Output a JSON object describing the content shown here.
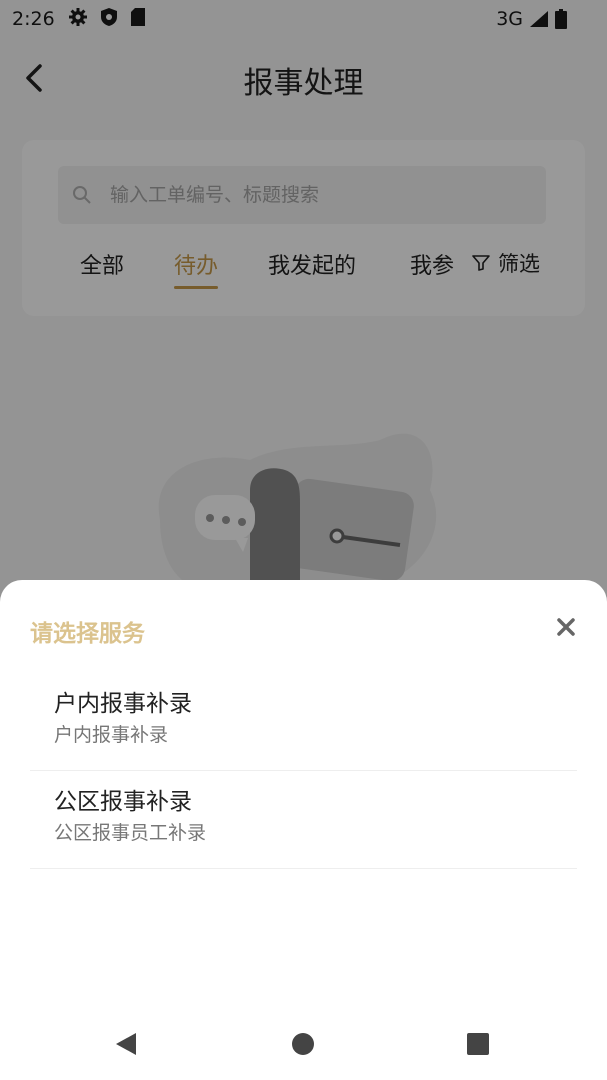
{
  "status_bar": {
    "time": "2:26",
    "network": "3G"
  },
  "header": {
    "title": "报事处理"
  },
  "search": {
    "placeholder": "输入工单编号、标题搜索",
    "value": ""
  },
  "tabs": [
    {
      "label": "全部",
      "active": false
    },
    {
      "label": "待办",
      "active": true
    },
    {
      "label": "我发起的",
      "active": false
    },
    {
      "label": "我参",
      "active": false
    }
  ],
  "filter": {
    "label": "筛选"
  },
  "sheet": {
    "title": "请选择服务",
    "options": [
      {
        "title": "户内报事补录",
        "subtitle": "户内报事补录"
      },
      {
        "title": "公区报事补录",
        "subtitle": "公区报事员工补录"
      }
    ]
  },
  "colors": {
    "accent": "#c69a4a",
    "sheet_title": "#dbc38e",
    "overlay": "rgba(0,0,0,0.4)"
  },
  "icons": [
    "settings-icon",
    "shield-icon",
    "sd-card-icon",
    "signal-icon",
    "battery-icon",
    "back-icon",
    "search-icon",
    "filter-icon",
    "close-icon",
    "nav-back-icon",
    "nav-home-icon",
    "nav-recents-icon"
  ]
}
